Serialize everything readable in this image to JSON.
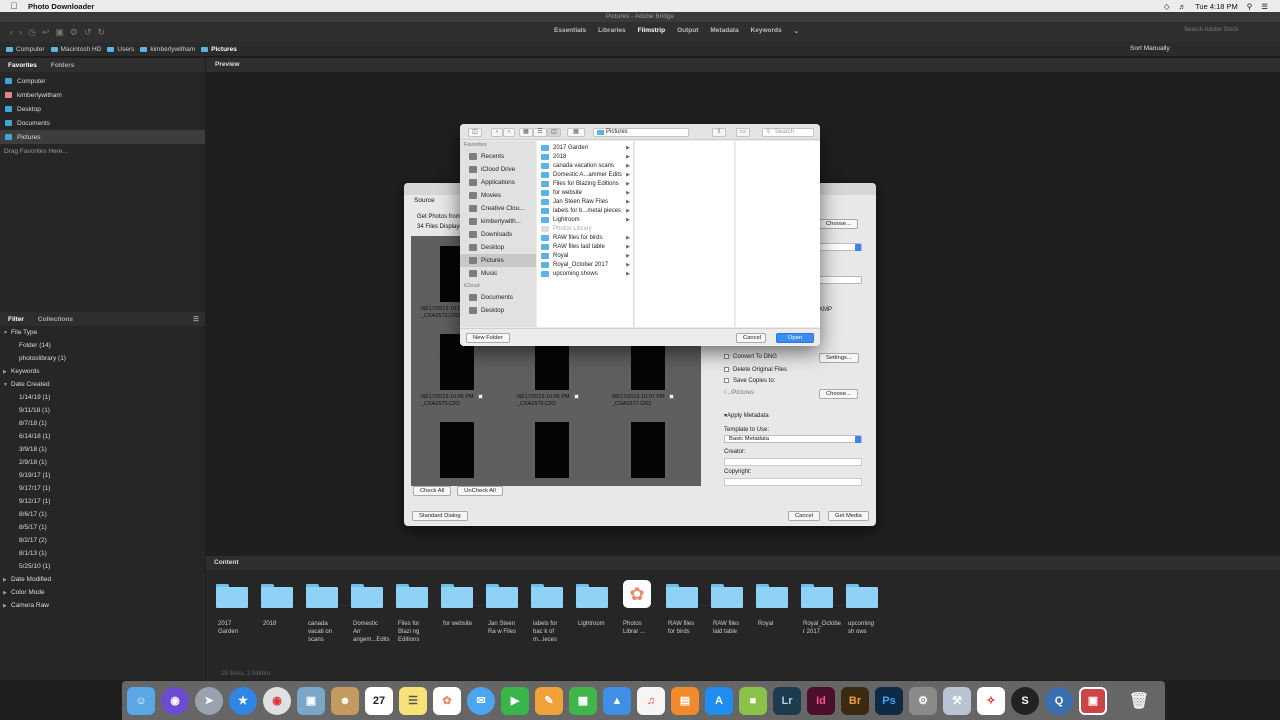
{
  "menubar": {
    "app_name": "Photo Downloader",
    "clock": "Tue 4:18 PM"
  },
  "window_title": "Pictures - Adobe Bridge",
  "workspaces": [
    "Essentials",
    "Libraries",
    "Filmstrip",
    "Output",
    "Metadata",
    "Keywords"
  ],
  "search_placeholder": "Search Adobe Stock",
  "path": [
    "Computer",
    "Macintosh HD",
    "Users",
    "kimberlywitham",
    "Pictures"
  ],
  "sort": "Sort Manually",
  "left_tabs": {
    "favorites": "Favorites",
    "folders": "Folders"
  },
  "favorites": [
    "Computer",
    "kimberlywitham",
    "Desktop",
    "Documents",
    "Pictures"
  ],
  "drag_favorites": "Drag Favorites Here...",
  "filter_tabs": {
    "filter": "Filter",
    "collections": "Collections"
  },
  "filters": {
    "file_type": "File Type",
    "file_type_items": [
      {
        "label": "Folder",
        "count": "(14)"
      },
      {
        "label": "photoslibrary",
        "count": "(1)"
      }
    ],
    "keywords": "Keywords",
    "date_created": "Date Created",
    "dates": [
      {
        "label": "1/14/19",
        "count": "(1)"
      },
      {
        "label": "9/11/18",
        "count": "(1)"
      },
      {
        "label": "8/7/18",
        "count": "(1)"
      },
      {
        "label": "6/14/18",
        "count": "(1)"
      },
      {
        "label": "3/9/18",
        "count": "(1)"
      },
      {
        "label": "2/9/18",
        "count": "(1)"
      },
      {
        "label": "9/19/17",
        "count": "(1)"
      },
      {
        "label": "9/17/17",
        "count": "(1)"
      },
      {
        "label": "9/12/17",
        "count": "(1)"
      },
      {
        "label": "8/6/17",
        "count": "(1)"
      },
      {
        "label": "8/5/17",
        "count": "(1)"
      },
      {
        "label": "8/2/17",
        "count": "(2)"
      },
      {
        "label": "8/1/13",
        "count": "(1)"
      },
      {
        "label": "5/25/10",
        "count": "(1)"
      }
    ],
    "date_modified": "Date Modified",
    "color_mode": "Color Mode",
    "camera_raw": "Camera Raw"
  },
  "preview_label": "Preview",
  "content_label": "Content",
  "content_items": [
    "2017 Garden",
    "2018",
    "canada vacati on scans",
    "Domestic Arr angem...Edits",
    "Files for Blazi ng Editions",
    "for website",
    "Jan Steen Ra w Files",
    "labels for bac k of m...ieces",
    "Lightroom",
    "Photos Librar ...",
    "RAW files for birds",
    "RAW files laid table",
    "Royal",
    "Royal_Octobe r 2017",
    "upcoming sh ows"
  ],
  "status_text": "15 items, 2 hidden",
  "downloader": {
    "source_label": "Source",
    "get_photos_from": "Get Photos from:",
    "files_displayed": "34 Files Displayed",
    "captions": [
      {
        "date": "08/17/2019 10:0...",
        "file": "_CSA1572.CR2"
      },
      {
        "date": "08/17/2019 10:06 PM",
        "file": "_CSA1575.CR2"
      },
      {
        "date": "08/17/2019 10:06 PM",
        "file": "_CSA1576.CR2"
      },
      {
        "date": "08/17/2019 10:07 PM",
        "file": "_CSA1577.CR2"
      }
    ],
    "check_all": "Check All",
    "uncheck_all": "UnCheck All",
    "choose": "Choose...",
    "xmp": "XMP",
    "convert_dng": "Convert To DNG",
    "settings": "Settings...",
    "delete_original": "Delete Original Files",
    "save_copies": "Save Copies to:",
    "save_path": "/.../Pictures",
    "choose2": "Choose...",
    "apply_metadata": "Apply Metadata",
    "template_label": "Template to Use:",
    "template_value": "Basic Metadata",
    "creator_label": "Creator:",
    "copyright_label": "Copyright:",
    "standard_dialog": "Standard Dialog",
    "cancel": "Cancel",
    "get_media": "Get Media"
  },
  "open_sheet": {
    "location": "Pictures",
    "search_placeholder": "Search",
    "sidebar_favorites_head": "Favorites",
    "sidebar_favorites": [
      "Recents",
      "iCloud Drive",
      "Applications",
      "Movies",
      "Creative Clou...",
      "kimberlywith...",
      "Downloads",
      "Desktop",
      "Pictures",
      "Music"
    ],
    "sidebar_icloud_head": "iCloud",
    "sidebar_icloud": [
      "Documents",
      "Desktop"
    ],
    "folders": [
      "2017 Garden",
      "2018",
      "canada vacation scans",
      "Domestic A...ammer Edits",
      "Files for Blazing Editions",
      "for website",
      "Jan Steen Raw Files",
      "labels for b...metal pieces",
      "Lightroom",
      "Photos Library",
      "RAW files for birds",
      "RAW files laid table",
      "Royal",
      "Royal_October 2017",
      "upcoming shows"
    ],
    "new_folder": "New Folder",
    "cancel": "Cancel",
    "open": "Open"
  },
  "dock": [
    "Finder",
    "Siri",
    "Launchpad",
    "Safari",
    "Chrome",
    "Preview",
    "Contacts",
    "Calendar",
    "Notes",
    "Photos",
    "Messages",
    "FaceTime",
    "Pages",
    "Numbers",
    "Keynote",
    "Music",
    "Books",
    "App Store",
    "Photo Booth",
    "Lr",
    "Id",
    "Br",
    "Ps",
    "Preferences",
    "Xcode",
    "Acrobat",
    "Sketch",
    "QuickTime",
    "Downloader",
    "Trash"
  ],
  "colors": {
    "accent_blue": "#3b8cf0",
    "folder_blue": "#8fd2f6",
    "panel_bg": "#262626"
  }
}
